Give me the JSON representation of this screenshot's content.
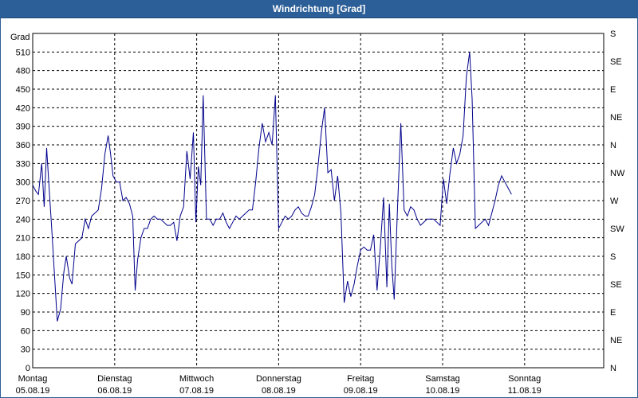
{
  "window": {
    "title": "Windrichtung [Grad]"
  },
  "chart_data": {
    "type": "line",
    "title": "Windrichtung [Grad]",
    "ylabel": "Grad",
    "ylim": [
      0,
      540
    ],
    "grid": true,
    "y_ticks": [
      0,
      30,
      60,
      90,
      120,
      150,
      180,
      210,
      240,
      270,
      300,
      330,
      360,
      390,
      420,
      450,
      480,
      510
    ],
    "y_right_ticks": [
      {
        "value": 0,
        "label": "N"
      },
      {
        "value": 45,
        "label": "NE"
      },
      {
        "value": 90,
        "label": "E"
      },
      {
        "value": 135,
        "label": "SE"
      },
      {
        "value": 180,
        "label": "S"
      },
      {
        "value": 225,
        "label": "SW"
      },
      {
        "value": 270,
        "label": "W"
      },
      {
        "value": 315,
        "label": "NW"
      },
      {
        "value": 360,
        "label": "N"
      },
      {
        "value": 405,
        "label": "NE"
      },
      {
        "value": 450,
        "label": "E"
      },
      {
        "value": 495,
        "label": "SE"
      },
      {
        "value": 540,
        "label": "S"
      }
    ],
    "x_ticks": [
      {
        "day": "Montag",
        "date": "05.08.19"
      },
      {
        "day": "Dienstag",
        "date": "06.08.19"
      },
      {
        "day": "Mittwoch",
        "date": "07.08.19"
      },
      {
        "day": "Donnerstag",
        "date": "08.08.19"
      },
      {
        "day": "Freitag",
        "date": "09.08.19"
      },
      {
        "day": "Samstag",
        "date": "10.08.19"
      },
      {
        "day": "Sonntag",
        "date": "11.08.19"
      }
    ],
    "line_color": "#00008b",
    "series": [
      {
        "x_unit": "days since 05.08.19 00:00",
        "points": [
          [
            0.0,
            295
          ],
          [
            0.04,
            285
          ],
          [
            0.07,
            280
          ],
          [
            0.11,
            330
          ],
          [
            0.14,
            260
          ],
          [
            0.17,
            355
          ],
          [
            0.2,
            290
          ],
          [
            0.23,
            230
          ],
          [
            0.27,
            140
          ],
          [
            0.3,
            75
          ],
          [
            0.34,
            95
          ],
          [
            0.38,
            155
          ],
          [
            0.41,
            180
          ],
          [
            0.45,
            145
          ],
          [
            0.48,
            135
          ],
          [
            0.52,
            200
          ],
          [
            0.56,
            205
          ],
          [
            0.6,
            210
          ],
          [
            0.64,
            240
          ],
          [
            0.68,
            225
          ],
          [
            0.72,
            245
          ],
          [
            0.76,
            250
          ],
          [
            0.8,
            255
          ],
          [
            0.84,
            290
          ],
          [
            0.88,
            345
          ],
          [
            0.92,
            375
          ],
          [
            0.95,
            345
          ],
          [
            0.98,
            310
          ],
          [
            1.02,
            300
          ],
          [
            1.06,
            300
          ],
          [
            1.1,
            270
          ],
          [
            1.14,
            275
          ],
          [
            1.18,
            265
          ],
          [
            1.22,
            245
          ],
          [
            1.25,
            125
          ],
          [
            1.28,
            175
          ],
          [
            1.32,
            210
          ],
          [
            1.36,
            225
          ],
          [
            1.4,
            225
          ],
          [
            1.44,
            240
          ],
          [
            1.48,
            245
          ],
          [
            1.52,
            240
          ],
          [
            1.56,
            240
          ],
          [
            1.6,
            235
          ],
          [
            1.64,
            230
          ],
          [
            1.68,
            230
          ],
          [
            1.72,
            235
          ],
          [
            1.76,
            205
          ],
          [
            1.8,
            245
          ],
          [
            1.84,
            260
          ],
          [
            1.88,
            350
          ],
          [
            1.92,
            305
          ],
          [
            1.96,
            380
          ],
          [
            1.99,
            235
          ],
          [
            2.02,
            325
          ],
          [
            2.05,
            295
          ],
          [
            2.08,
            440
          ],
          [
            2.12,
            240
          ],
          [
            2.16,
            240
          ],
          [
            2.2,
            230
          ],
          [
            2.24,
            240
          ],
          [
            2.28,
            240
          ],
          [
            2.32,
            250
          ],
          [
            2.36,
            235
          ],
          [
            2.4,
            225
          ],
          [
            2.44,
            235
          ],
          [
            2.48,
            245
          ],
          [
            2.52,
            240
          ],
          [
            2.56,
            245
          ],
          [
            2.6,
            250
          ],
          [
            2.64,
            255
          ],
          [
            2.68,
            255
          ],
          [
            2.72,
            300
          ],
          [
            2.76,
            355
          ],
          [
            2.8,
            395
          ],
          [
            2.84,
            365
          ],
          [
            2.88,
            380
          ],
          [
            2.92,
            360
          ],
          [
            2.96,
            440
          ],
          [
            3.0,
            225
          ],
          [
            3.04,
            235
          ],
          [
            3.08,
            245
          ],
          [
            3.12,
            240
          ],
          [
            3.16,
            245
          ],
          [
            3.2,
            255
          ],
          [
            3.24,
            260
          ],
          [
            3.28,
            250
          ],
          [
            3.32,
            245
          ],
          [
            3.36,
            245
          ],
          [
            3.4,
            260
          ],
          [
            3.44,
            280
          ],
          [
            3.48,
            325
          ],
          [
            3.52,
            380
          ],
          [
            3.56,
            420
          ],
          [
            3.6,
            315
          ],
          [
            3.64,
            320
          ],
          [
            3.68,
            270
          ],
          [
            3.72,
            310
          ],
          [
            3.76,
            250
          ],
          [
            3.8,
            105
          ],
          [
            3.84,
            140
          ],
          [
            3.88,
            115
          ],
          [
            3.92,
            135
          ],
          [
            3.96,
            165
          ],
          [
            4.0,
            190
          ],
          [
            4.04,
            195
          ],
          [
            4.08,
            190
          ],
          [
            4.12,
            190
          ],
          [
            4.16,
            215
          ],
          [
            4.2,
            125
          ],
          [
            4.24,
            195
          ],
          [
            4.28,
            275
          ],
          [
            4.32,
            130
          ],
          [
            4.35,
            265
          ],
          [
            4.38,
            165
          ],
          [
            4.41,
            110
          ],
          [
            4.45,
            260
          ],
          [
            4.49,
            395
          ],
          [
            4.53,
            255
          ],
          [
            4.57,
            245
          ],
          [
            4.61,
            260
          ],
          [
            4.65,
            255
          ],
          [
            4.69,
            240
          ],
          [
            4.73,
            230
          ],
          [
            4.77,
            235
          ],
          [
            4.81,
            240
          ],
          [
            4.85,
            240
          ],
          [
            4.89,
            240
          ],
          [
            4.93,
            235
          ],
          [
            4.97,
            230
          ],
          [
            5.01,
            305
          ],
          [
            5.05,
            265
          ],
          [
            5.09,
            315
          ],
          [
            5.13,
            355
          ],
          [
            5.17,
            330
          ],
          [
            5.21,
            345
          ],
          [
            5.25,
            375
          ],
          [
            5.29,
            470
          ],
          [
            5.33,
            510
          ],
          [
            5.36,
            435
          ],
          [
            5.4,
            225
          ],
          [
            5.44,
            230
          ],
          [
            5.48,
            235
          ],
          [
            5.52,
            240
          ],
          [
            5.56,
            230
          ],
          [
            5.6,
            250
          ],
          [
            5.64,
            270
          ],
          [
            5.68,
            295
          ],
          [
            5.72,
            310
          ],
          [
            5.76,
            300
          ],
          [
            5.8,
            290
          ],
          [
            5.84,
            280
          ]
        ]
      }
    ]
  }
}
